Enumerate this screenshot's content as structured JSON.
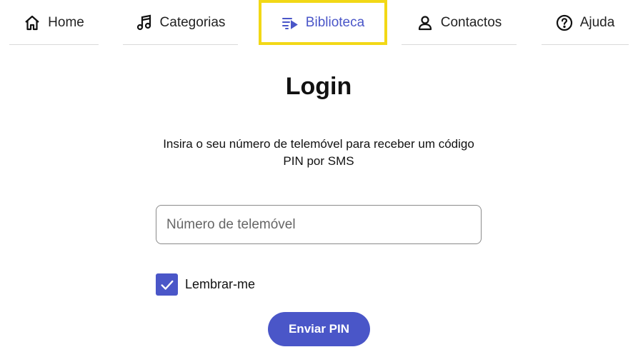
{
  "nav": {
    "items": [
      {
        "label": "Home",
        "icon": "home-icon"
      },
      {
        "label": "Categorias",
        "icon": "music-note-icon"
      },
      {
        "label": "Biblioteca",
        "icon": "playlist-icon",
        "active": true
      },
      {
        "label": "Contactos",
        "icon": "person-icon"
      },
      {
        "label": "Ajuda",
        "icon": "help-circle-icon"
      }
    ]
  },
  "login": {
    "title": "Login",
    "instructions": "Insira o seu número de telemóvel para receber um código PIN por SMS",
    "phone_placeholder": "Número de telemóvel",
    "phone_value": "",
    "remember_label": "Lembrar-me",
    "remember_checked": true,
    "submit_label": "Enviar PIN"
  },
  "colors": {
    "accent": "#4a56c8",
    "highlight_border": "#f2d816",
    "divider": "#d9d9d9"
  }
}
